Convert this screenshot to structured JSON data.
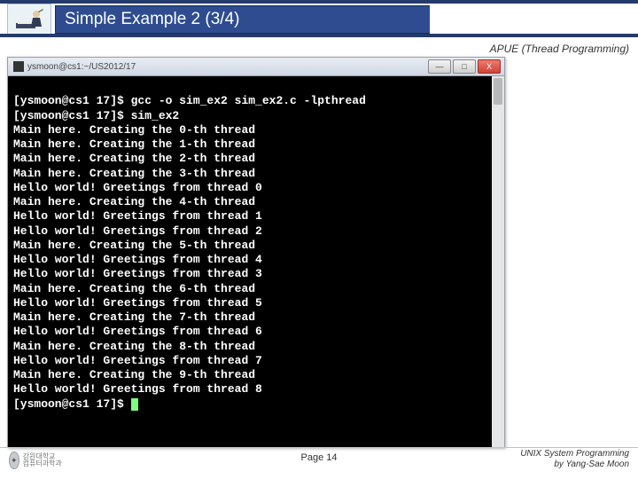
{
  "header": {
    "title": "Simple Example 2 (3/4)",
    "subtitle": "APUE (Thread Programming)"
  },
  "terminal": {
    "windowTitle": "ysmoon@cs1:~/US2012/17",
    "minLabel": "—",
    "maxLabel": "□",
    "closeLabel": "X",
    "lines": [
      "[ysmoon@cs1 17]$ gcc -o sim_ex2 sim_ex2.c -lpthread",
      "[ysmoon@cs1 17]$ sim_ex2",
      "Main here. Creating the 0-th thread",
      "Main here. Creating the 1-th thread",
      "Main here. Creating the 2-th thread",
      "Main here. Creating the 3-th thread",
      "Hello world! Greetings from thread 0",
      "Main here. Creating the 4-th thread",
      "Hello world! Greetings from thread 1",
      "Hello world! Greetings from thread 2",
      "Main here. Creating the 5-th thread",
      "Hello world! Greetings from thread 4",
      "Hello world! Greetings from thread 3",
      "Main here. Creating the 6-th thread",
      "Hello world! Greetings from thread 5",
      "Main here. Creating the 7-th thread",
      "Hello world! Greetings from thread 6",
      "Main here. Creating the 8-th thread",
      "Hello world! Greetings from thread 7",
      "Main here. Creating the 9-th thread",
      "Hello world! Greetings from thread 8"
    ],
    "promptTail": "[ysmoon@cs1 17]$ "
  },
  "footer": {
    "page": "Page 14",
    "line1": "UNIX System Programming",
    "line2": "by Yang-Sae Moon",
    "uniLines": "강원대학교\n컴퓨터과학과"
  }
}
